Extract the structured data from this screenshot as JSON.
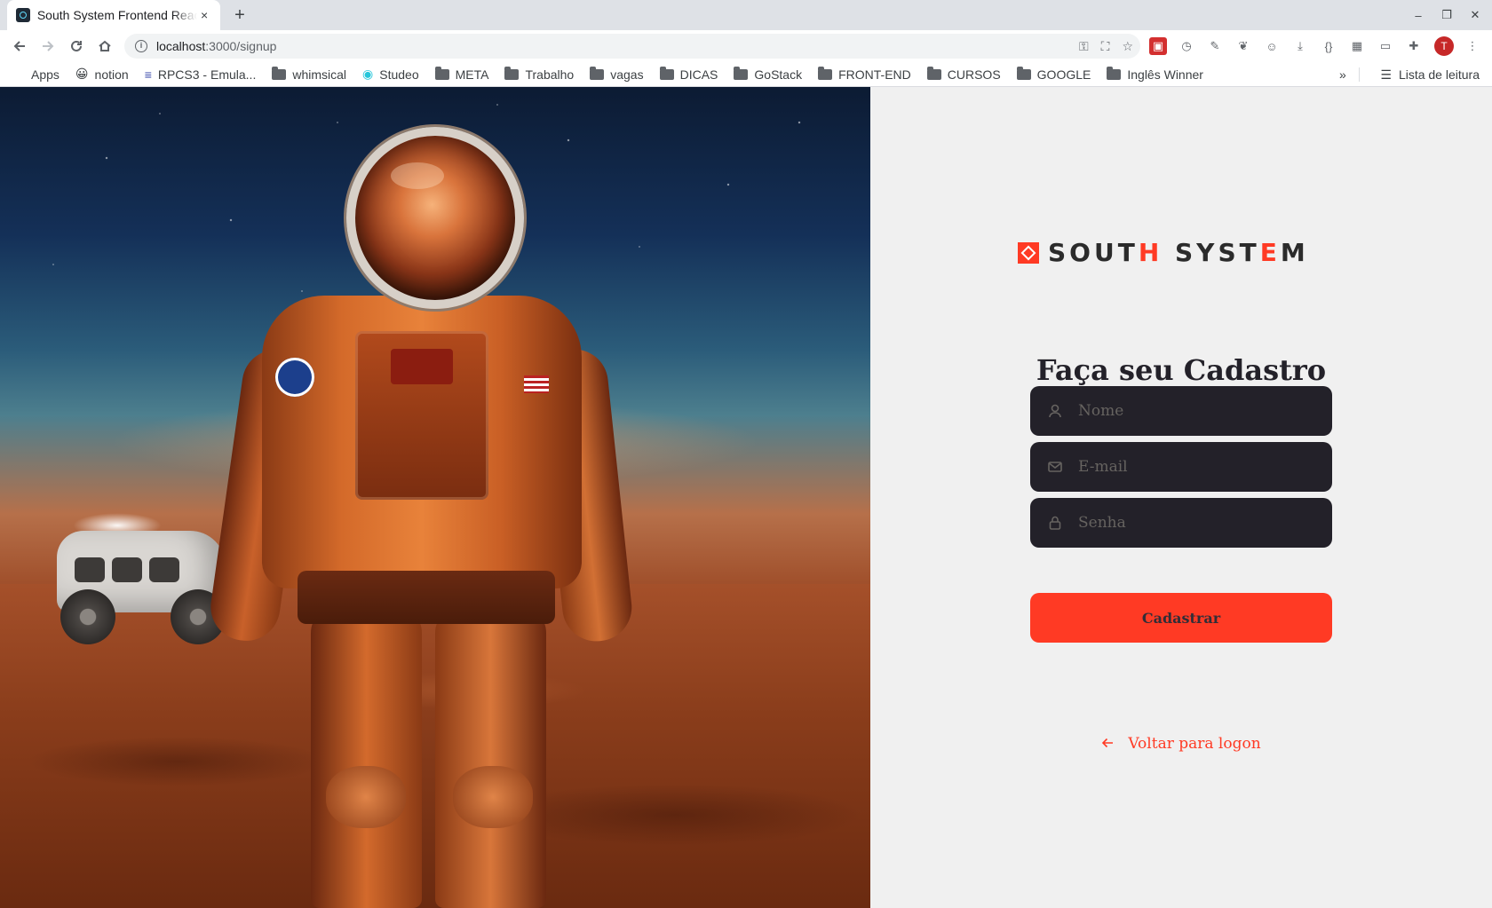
{
  "browser": {
    "tab_title": "South System Frontend React",
    "tab_close": "×",
    "new_tab": "+",
    "url_host": "localhost",
    "url_path": ":3000/signup",
    "window_controls": [
      "–",
      "❐",
      "✕"
    ],
    "bookmarks": [
      {
        "label": "Apps",
        "icon": "apps-grid-icon"
      },
      {
        "label": "notion",
        "icon": "emoji-icon"
      },
      {
        "label": "RPCS3 - Emula...",
        "icon": "rpcs3-icon"
      },
      {
        "label": "whimsical",
        "icon": "folder-icon"
      },
      {
        "label": "Studeo",
        "icon": "studeo-icon"
      },
      {
        "label": "META",
        "icon": "folder-icon"
      },
      {
        "label": "Trabalho",
        "icon": "folder-icon"
      },
      {
        "label": "vagas",
        "icon": "folder-icon"
      },
      {
        "label": "DICAS",
        "icon": "folder-icon"
      },
      {
        "label": "GoStack",
        "icon": "folder-icon"
      },
      {
        "label": "FRONT-END",
        "icon": "folder-icon"
      },
      {
        "label": "CURSOS",
        "icon": "folder-icon"
      },
      {
        "label": "GOOGLE",
        "icon": "folder-icon"
      },
      {
        "label": "Inglês Winner",
        "icon": "folder-icon"
      }
    ],
    "bookmarks_overflow": "»",
    "reading_list": "Lista de leitura",
    "profile_initial": "T"
  },
  "brand": {
    "name_part1": "SOUT",
    "name_accent": "H",
    "name_part2": " SYST",
    "name_accent2": "E",
    "name_part3": "M",
    "color": "#ff3a24"
  },
  "form": {
    "title": "Faça seu Cadastro",
    "name_placeholder": "Nome",
    "email_placeholder": "E-mail",
    "password_placeholder": "Senha",
    "submit_label": "Cadastrar"
  },
  "back_link": {
    "label": "Voltar para logon"
  },
  "colors": {
    "accent": "#ff3a24",
    "input_bg": "#232129",
    "panel_bg": "#f0f0f0",
    "placeholder": "#666360"
  }
}
